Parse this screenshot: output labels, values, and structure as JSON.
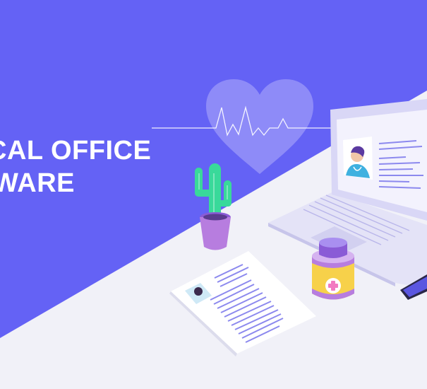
{
  "headline": {
    "line1": "CAL OFFICE",
    "line2": "WARE"
  },
  "icons": [
    "heart-icon",
    "heartbeat-line",
    "cactus-pot",
    "laptop",
    "doctor-avatar",
    "medicine-bottle",
    "medical-cross-icon",
    "paper-document",
    "smartphone"
  ],
  "colors": {
    "background": "#6462f5",
    "floor": "#f1f1f8",
    "heart": "#9c9af8",
    "cactus": "#39d99a",
    "pot": "#b77ddf",
    "bottle_cap": "#8a5bd6",
    "bottle_label": "#f7d14a",
    "cross": "#f27ac1",
    "laptop": "#e4e3f7",
    "text_lines": "#8c89ee"
  }
}
